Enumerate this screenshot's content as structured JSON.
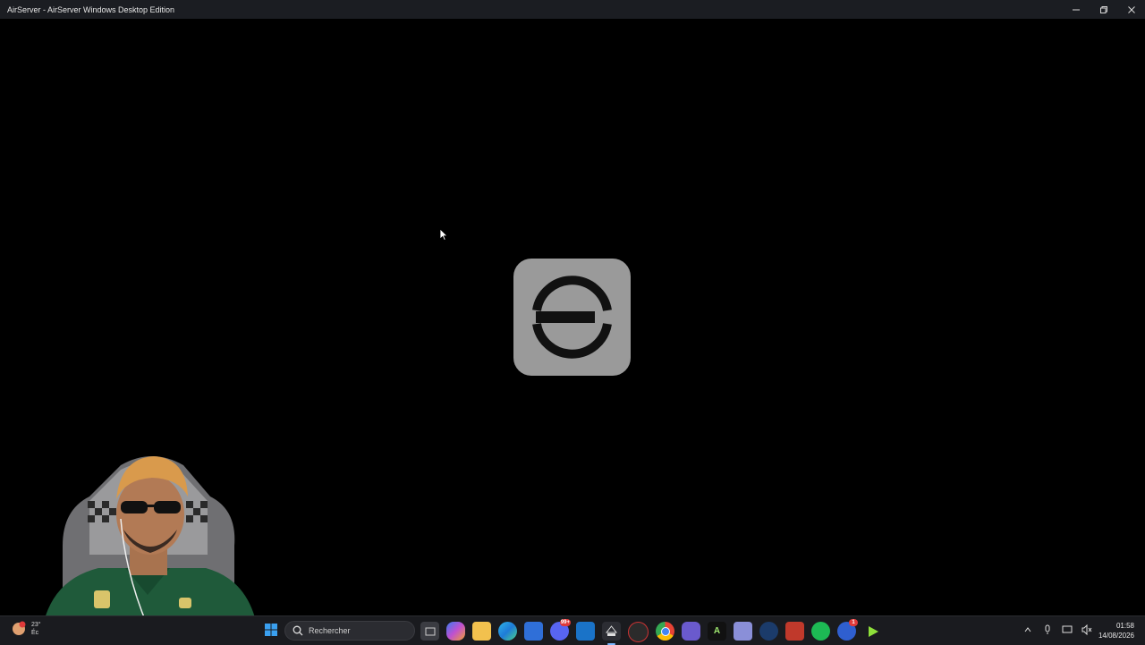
{
  "window": {
    "title": "AirServer - AirServer Windows Desktop Edition",
    "minimize_icon": "minimize-icon",
    "restore_icon": "restore-icon",
    "close_icon": "close-icon"
  },
  "content": {
    "logo_icon": "airserver-logo-icon",
    "logo_color": "#9a9a9a"
  },
  "taskbar": {
    "weather": {
      "temp": "23°",
      "sub": "Éc"
    },
    "search_placeholder": "Rechercher",
    "apps": [
      {
        "name": "task-view-icon",
        "badge": ""
      },
      {
        "name": "copilot-icon",
        "badge": ""
      },
      {
        "name": "file-explorer-icon",
        "badge": ""
      },
      {
        "name": "edge-icon",
        "badge": ""
      },
      {
        "name": "microsoft-store-icon",
        "badge": ""
      },
      {
        "name": "discord-icon",
        "badge": "99+"
      },
      {
        "name": "outlook-icon",
        "badge": ""
      },
      {
        "name": "airserver-app-icon",
        "badge": ""
      },
      {
        "name": "app-icon",
        "badge": ""
      },
      {
        "name": "chrome-icon",
        "badge": ""
      },
      {
        "name": "game-controller-icon",
        "badge": ""
      },
      {
        "name": "anima-icon",
        "badge": ""
      },
      {
        "name": "app-window-icon",
        "badge": ""
      },
      {
        "name": "app-drop-icon",
        "badge": ""
      },
      {
        "name": "voice-app-icon",
        "badge": ""
      },
      {
        "name": "spotify-icon",
        "badge": ""
      },
      {
        "name": "app-icon-2",
        "badge": "1"
      },
      {
        "name": "play-icon",
        "badge": ""
      }
    ],
    "clock": {
      "time": "01:58",
      "date": "14/08/2026"
    }
  }
}
